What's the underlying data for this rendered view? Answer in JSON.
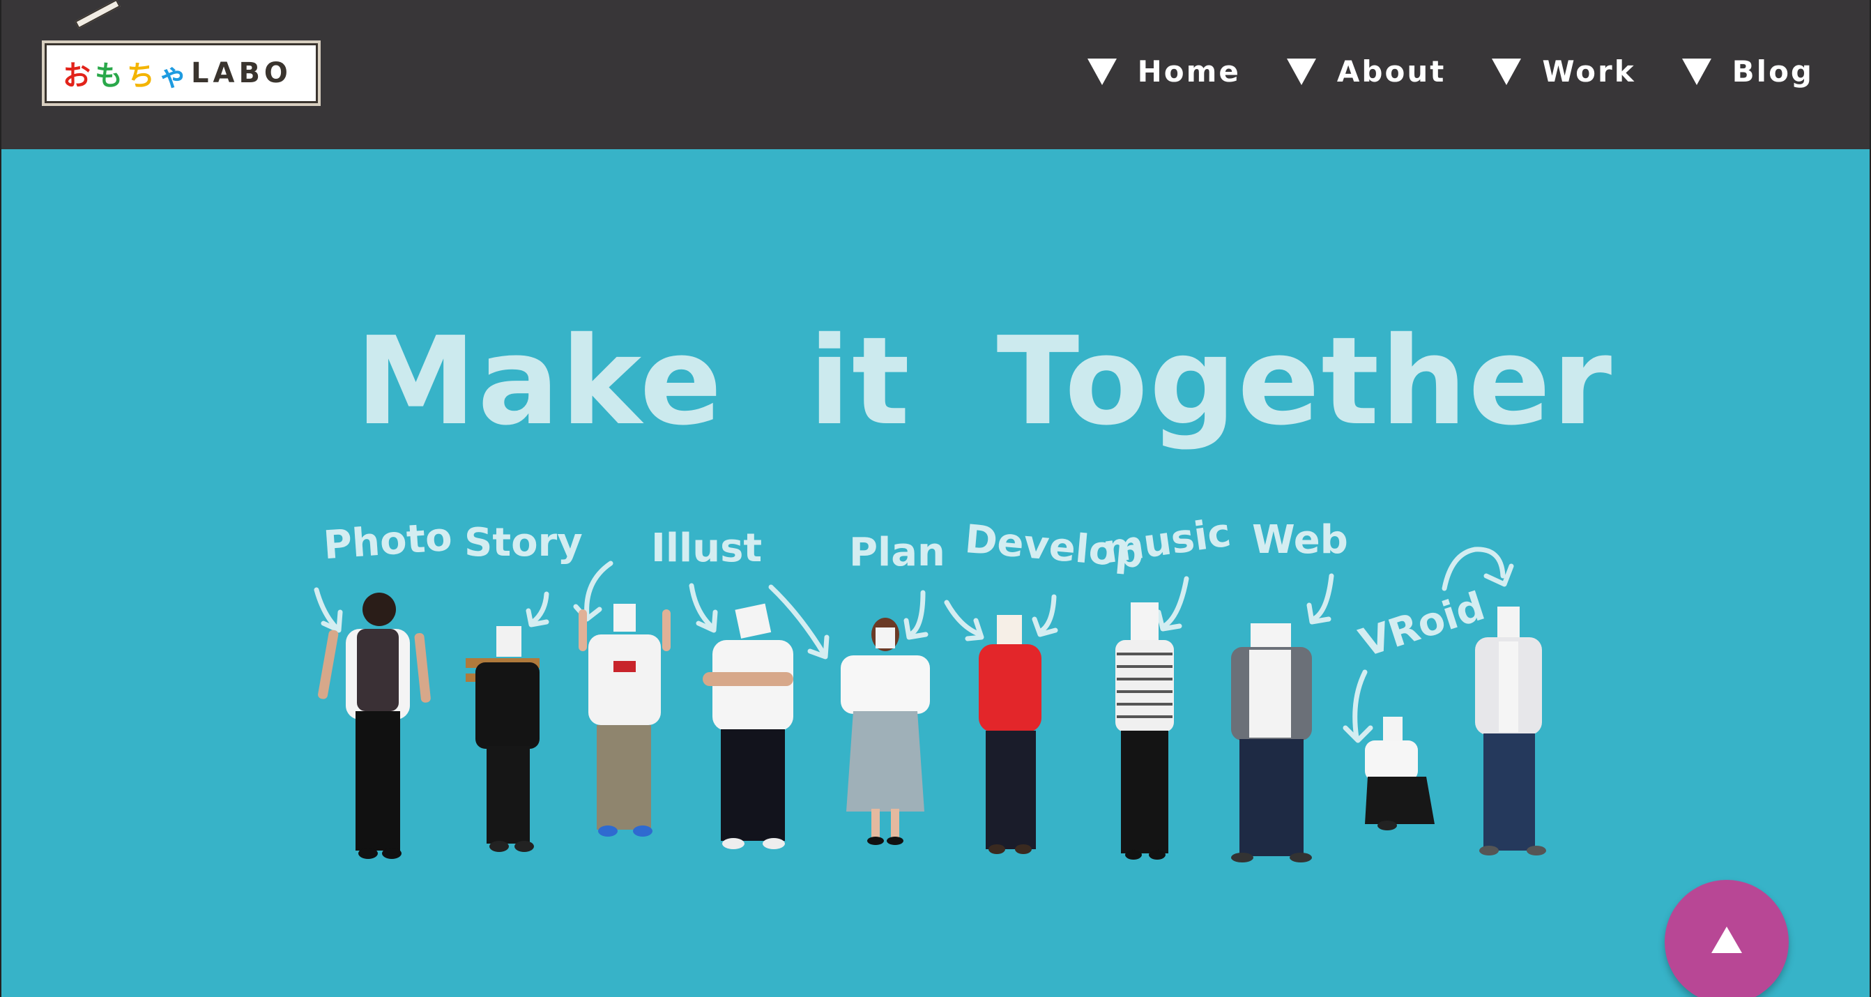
{
  "header": {
    "logo_text": "おもちゃLABO",
    "nav": [
      {
        "label": "Home"
      },
      {
        "label": "About"
      },
      {
        "label": "Work"
      },
      {
        "label": "Blog"
      }
    ]
  },
  "hero": {
    "title": "Make it Together",
    "roles": [
      "Photo",
      "Story",
      "Illust",
      "Plan",
      "Develop",
      "music",
      "Web",
      "VRoid"
    ]
  },
  "colors": {
    "header_bg": "#383638",
    "hero_bg": "#37b3c8",
    "scroll_button": "#b84795"
  },
  "icons": {
    "nav_arrow": "triangle-down-icon",
    "scroll_top": "triangle-up-icon"
  }
}
